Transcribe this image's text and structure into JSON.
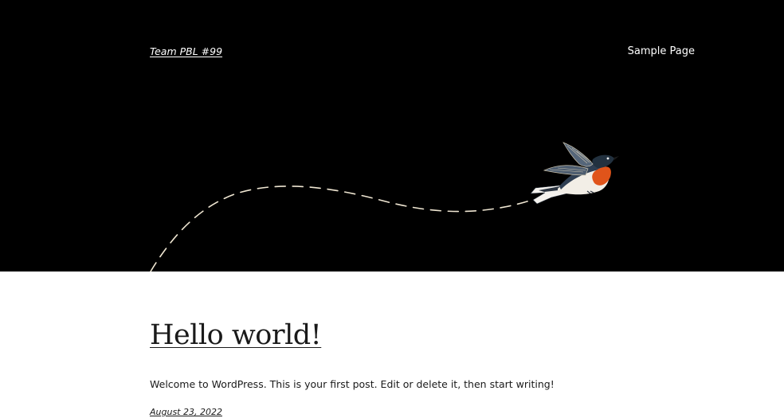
{
  "header": {
    "site_title": "Team PBL #99",
    "nav_items": [
      {
        "label": "Sample Page"
      }
    ],
    "background_color": "#000000",
    "hero_icon": "bird-icon"
  },
  "post": {
    "title": "Hello world!",
    "excerpt": "Welcome to WordPress. This is your first post. Edit or delete it, then start writing!",
    "date": "August 23, 2022"
  },
  "colors": {
    "text_dark": "#1a1a1a",
    "text_light": "#ffffff",
    "bird_breast": "#e0541a",
    "bird_wing": "#3b4a5c"
  }
}
